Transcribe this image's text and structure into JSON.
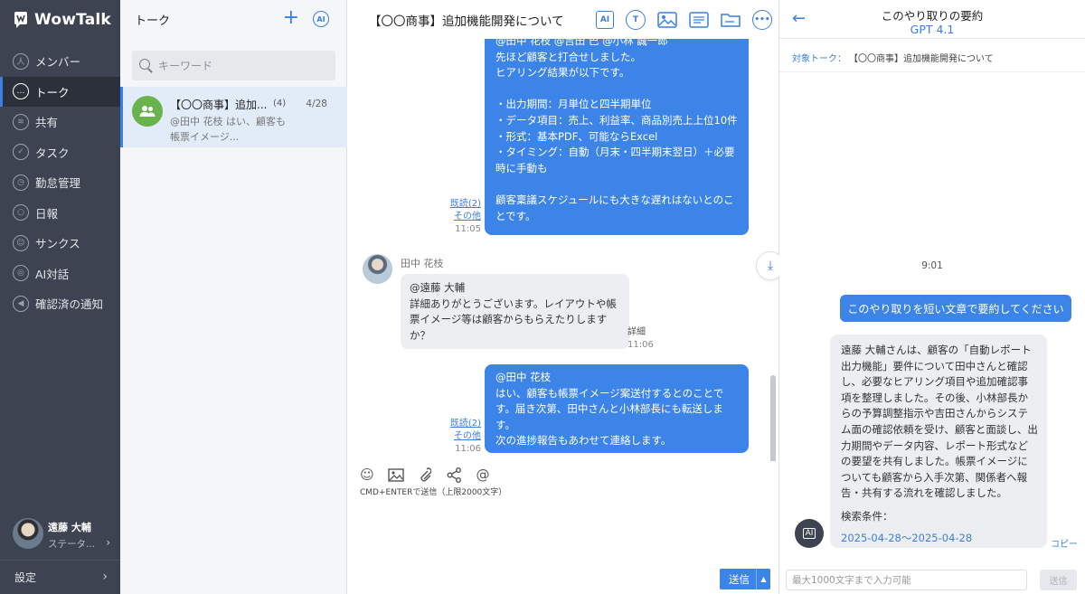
{
  "app": {
    "name": "WowTalk"
  },
  "nav": {
    "items": [
      {
        "label": "メンバー",
        "icon": "person-icon",
        "glyph": "人"
      },
      {
        "label": "トーク",
        "icon": "chat-bubble-icon",
        "glyph": "…"
      },
      {
        "label": "共有",
        "icon": "share-feed-icon",
        "glyph": "≋"
      },
      {
        "label": "タスク",
        "icon": "clipboard-icon",
        "glyph": "✓"
      },
      {
        "label": "勤怠管理",
        "icon": "clock-icon",
        "glyph": "◷"
      },
      {
        "label": "日報",
        "icon": "report-person-icon",
        "glyph": "○"
      },
      {
        "label": "サンクス",
        "icon": "smile-icon",
        "glyph": "☺"
      },
      {
        "label": "AI対話",
        "icon": "ai-chat-icon",
        "glyph": "◎"
      },
      {
        "label": "確認済の通知",
        "icon": "megaphone-icon",
        "glyph": "◀"
      }
    ],
    "active_index": 1,
    "user": {
      "name": "遠藤 大輔",
      "status": "ステータ..."
    },
    "settings_label": "設定"
  },
  "talk_list": {
    "title": "トーク",
    "search_placeholder": "キーワード",
    "items": [
      {
        "title": "【〇〇商事】追加...",
        "count": "(4)",
        "date": "4/28",
        "preview": "@田中 花枝 はい、顧客も帳票イメージ..."
      }
    ]
  },
  "chat": {
    "title": "【〇〇商事】追加機能開発について",
    "tools": [
      "ai-icon",
      "translate-icon",
      "image-gallery-icon",
      "notes-icon",
      "folder-icon",
      "more-icon"
    ],
    "messages": [
      {
        "from": "me",
        "text": "@田中 花枝 @吉田 巴 @小林 誠一郎\n先ほど顧客と打合せしました。\nヒアリング結果が以下です。\n\n・出力期間：月単位と四半期単位\n・データ項目：売上、利益率、商品別売上上位10件\n・形式：基本PDF、可能ならExcel\n・タイミング：自動（月末・四半期末翌日）＋必要時に手動も\n\n顧客稟議スケジュールにも大きな遅れはないとのことです。",
        "read": "既読(2)",
        "other": "その他",
        "time": "11:05"
      },
      {
        "from": "田中 花枝",
        "text": "@遠藤 大輔\n詳細ありがとうございます。レイアウトや帳票イメージ等は顧客からもらえたりしますか？",
        "detail": "詳細",
        "time": "11:06"
      },
      {
        "from": "me",
        "text": "@田中 花枝\nはい、顧客も帳票イメージ案送付するとのことです。届き次第、田中さんと小林部長にも転送します。\n次の進捗報告もあわせて連絡します。",
        "read": "既読(2)",
        "other": "その他",
        "time": "11:06"
      }
    ],
    "composer": {
      "hint": "CMD+ENTERで送信（上限2000文字）",
      "send_label": "送信"
    }
  },
  "summary": {
    "title": "このやり取りの要約",
    "model": "GPT 4.1",
    "target_label": "対象トーク：",
    "target_value": "【〇〇商事】追加機能開発について",
    "time": "9:01",
    "user_prompt": "このやり取りを短い文章で要約してください",
    "ai_response": "遠藤 大輔さんは、顧客の「自動レポート出力機能」要件について田中さんと確認し、必要なヒアリング項目や追加確認事項を整理しました。その後、小林部長からの予算調整指示や吉田さんからシステム面の確認依頼を受け、顧客と面談し、出力期間やデータ内容、レポート形式などの要望を共有しました。帳票イメージについても顧客から入手次第、関係者へ報告・共有する流れを確認しました。",
    "conditions_label": "検索条件：",
    "conditions_value": "2025-04-28〜2025-04-28",
    "copy_label": "コピー",
    "input_placeholder": "最大1000文字まで入力可能",
    "send_label": "送信"
  },
  "colors": {
    "accent": "#3a7fe4",
    "bubble_mine": "#3d84e8",
    "nav_bg": "#3d4350",
    "group_avatar": "#69b34c"
  }
}
